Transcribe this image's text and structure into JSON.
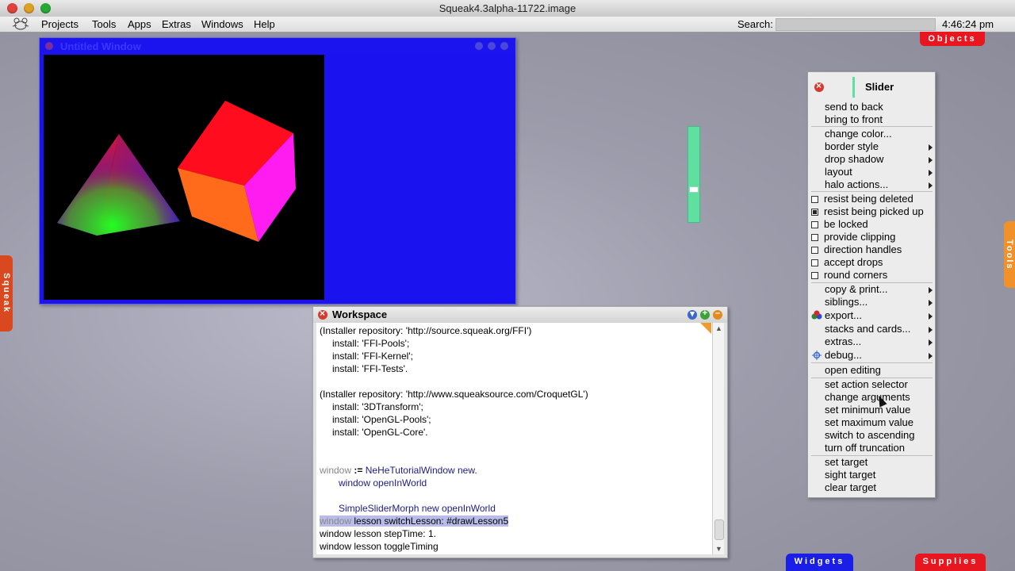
{
  "os": {
    "title": "Squeak4.3alpha-11722.image"
  },
  "menubar": {
    "items": [
      "Projects",
      "Tools",
      "Apps",
      "Extras",
      "Windows",
      "Help"
    ],
    "search_label": "Search:",
    "search_value": "",
    "clock": "4:46:24 pm"
  },
  "flaps": {
    "objects": "Objects",
    "widgets": "Widgets",
    "supplies": "Supplies",
    "squeak": "Squeak",
    "tools": "Tools"
  },
  "untitled_window": {
    "title": "Untitled Window"
  },
  "slider": {
    "value": 0.68
  },
  "workspace": {
    "title": "Workspace",
    "lines": [
      "(Installer repository: 'http://source.squeak.org/FFI')",
      "install: 'FFI-Pools';",
      "install: 'FFI-Kernel';",
      "install: 'FFI-Tests'.",
      "(Installer repository: 'http://www.squeaksource.com/CroquetGL')",
      "install: '3DTransform';",
      "install: 'OpenGL-Pools';",
      "install: 'OpenGL-Core'.",
      "window",
      ":=",
      "NeHeTutorialWindow new.",
      "window openInWorld",
      "SimpleSliderMorph new openInWorld",
      "window",
      "lesson switchLesson: #drawLesson5",
      "window lesson stepTime: 1.",
      "window lesson toggleTiming"
    ]
  },
  "halo_menu": {
    "title": "Slider",
    "items": {
      "send_to_back": "send to back",
      "bring_to_front": "bring to front",
      "change_color": "change color...",
      "border_style": "border style",
      "drop_shadow": "drop shadow",
      "layout": "layout",
      "halo_actions": "halo actions...",
      "resist_being_deleted": "resist being deleted",
      "resist_being_picked_up": "resist being picked up",
      "be_locked": "be locked",
      "provide_clipping": "provide clipping",
      "direction_handles": "direction handles",
      "accept_drops": "accept drops",
      "round_corners": "round corners",
      "copy_print": "copy & print...",
      "siblings": "siblings...",
      "export": "export...",
      "stacks_and_cards": "stacks and cards...",
      "extras": "extras...",
      "debug": "debug...",
      "open_editing": "open editing",
      "set_action_selector": "set action selector",
      "change_arguments": "change arguments",
      "set_minimum_value": "set minimum value",
      "set_maximum_value": "set maximum value",
      "switch_to_ascending": "switch to ascending",
      "turn_off_truncation": "turn off truncation",
      "set_target": "set target",
      "sight_target": "sight target",
      "clear_target": "clear target"
    },
    "checked": {
      "resist_being_picked_up": true
    }
  },
  "colors": {
    "slider": "#5de0a0",
    "window_blue": "#1a12ef",
    "flap_red": "#e8161e",
    "flap_blue": "#1a1ee6",
    "flap_orange": "#f0912a"
  }
}
